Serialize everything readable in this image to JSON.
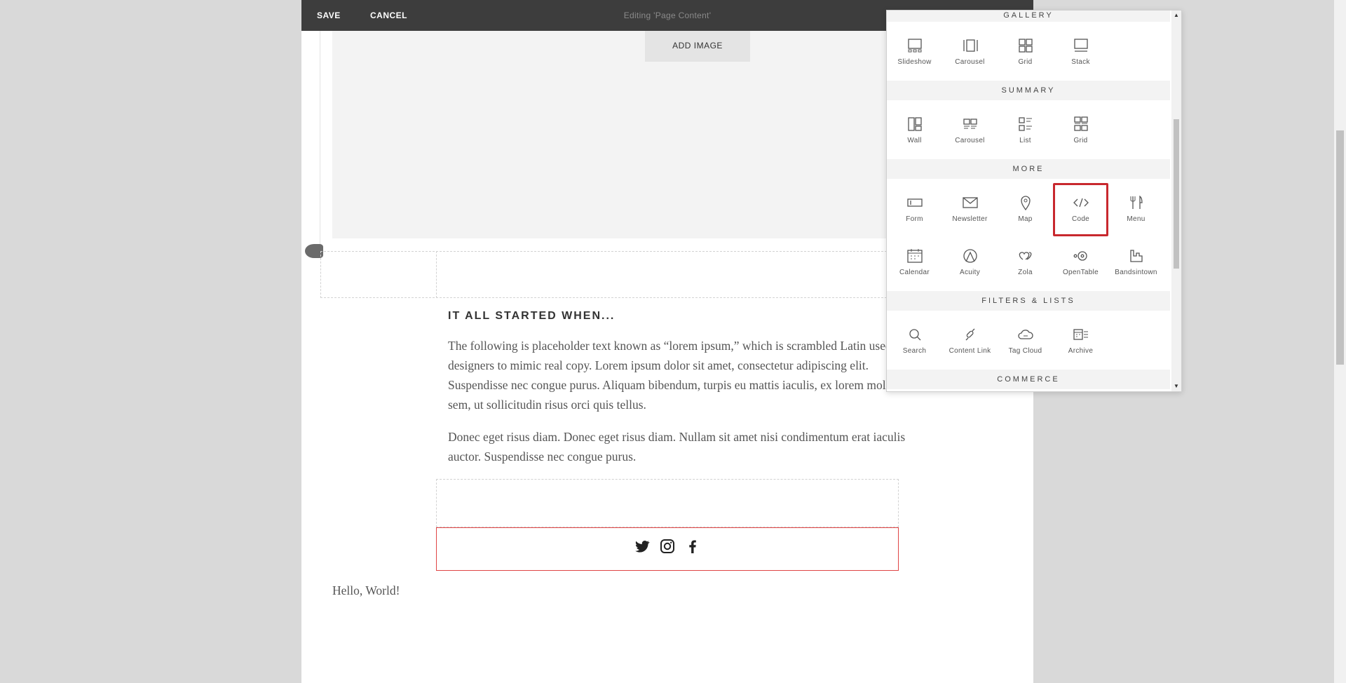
{
  "topbar": {
    "save_label": "SAVE",
    "cancel_label": "CANCEL",
    "title": "Editing 'Page Content'"
  },
  "image_block": {
    "add_image_label": "ADD IMAGE"
  },
  "content": {
    "heading": "IT ALL STARTED WHEN...",
    "paragraph1": "The following is placeholder text known as “lorem ipsum,” which is scrambled Latin used by designers to mimic real copy. Lorem ipsum dolor sit amet, consectetur adipiscing elit. Suspendisse nec congue purus. Aliquam bibendum, turpis eu mattis iaculis, ex lorem mollis sem, ut sollicitudin risus orci quis tellus.",
    "paragraph2": "Donec eget risus diam. Donec eget risus diam. Nullam sit amet nisi condimentum erat iaculis auctor. Suspendisse nec congue purus.",
    "social_icons": [
      "twitter-icon",
      "instagram-icon",
      "facebook-icon"
    ],
    "hello": "Hello, World!"
  },
  "panel": {
    "sections": {
      "gallery": {
        "title": "GALLERY",
        "items": [
          {
            "label": "Slideshow",
            "icon": "slideshow-icon"
          },
          {
            "label": "Carousel",
            "icon": "carousel-icon"
          },
          {
            "label": "Grid",
            "icon": "grid-icon"
          },
          {
            "label": "Stack",
            "icon": "stack-icon"
          }
        ]
      },
      "summary": {
        "title": "SUMMARY",
        "items": [
          {
            "label": "Wall",
            "icon": "wall-icon"
          },
          {
            "label": "Carousel",
            "icon": "carousel-icon"
          },
          {
            "label": "List",
            "icon": "list-icon"
          },
          {
            "label": "Grid",
            "icon": "grid-icon"
          }
        ]
      },
      "more": {
        "title": "MORE",
        "items": [
          {
            "label": "Form",
            "icon": "form-icon"
          },
          {
            "label": "Newsletter",
            "icon": "envelope-icon"
          },
          {
            "label": "Map",
            "icon": "map-pin-icon"
          },
          {
            "label": "Code",
            "icon": "code-icon"
          },
          {
            "label": "Menu",
            "icon": "fork-knife-icon"
          },
          {
            "label": "Calendar",
            "icon": "calendar-icon"
          },
          {
            "label": "Acuity",
            "icon": "acuity-icon"
          },
          {
            "label": "Zola",
            "icon": "zola-icon"
          },
          {
            "label": "OpenTable",
            "icon": "opentable-icon"
          },
          {
            "label": "Bandsintown",
            "icon": "bandsintown-icon"
          }
        ]
      },
      "filters": {
        "title": "FILTERS & LISTS",
        "items": [
          {
            "label": "Search",
            "icon": "search-icon"
          },
          {
            "label": "Content Link",
            "icon": "link-icon"
          },
          {
            "label": "Tag Cloud",
            "icon": "tag-cloud-icon"
          },
          {
            "label": "Archive",
            "icon": "archive-icon"
          }
        ]
      },
      "commerce": {
        "title": "COMMERCE"
      }
    },
    "highlighted_item": "Code",
    "highlight_color": "#c8282e"
  },
  "colors": {
    "topbar_bg": "#3d3d3d",
    "page_bg": "#ffffff",
    "outer_bg": "#d9d9d9",
    "selected_block_border": "#e04545"
  }
}
